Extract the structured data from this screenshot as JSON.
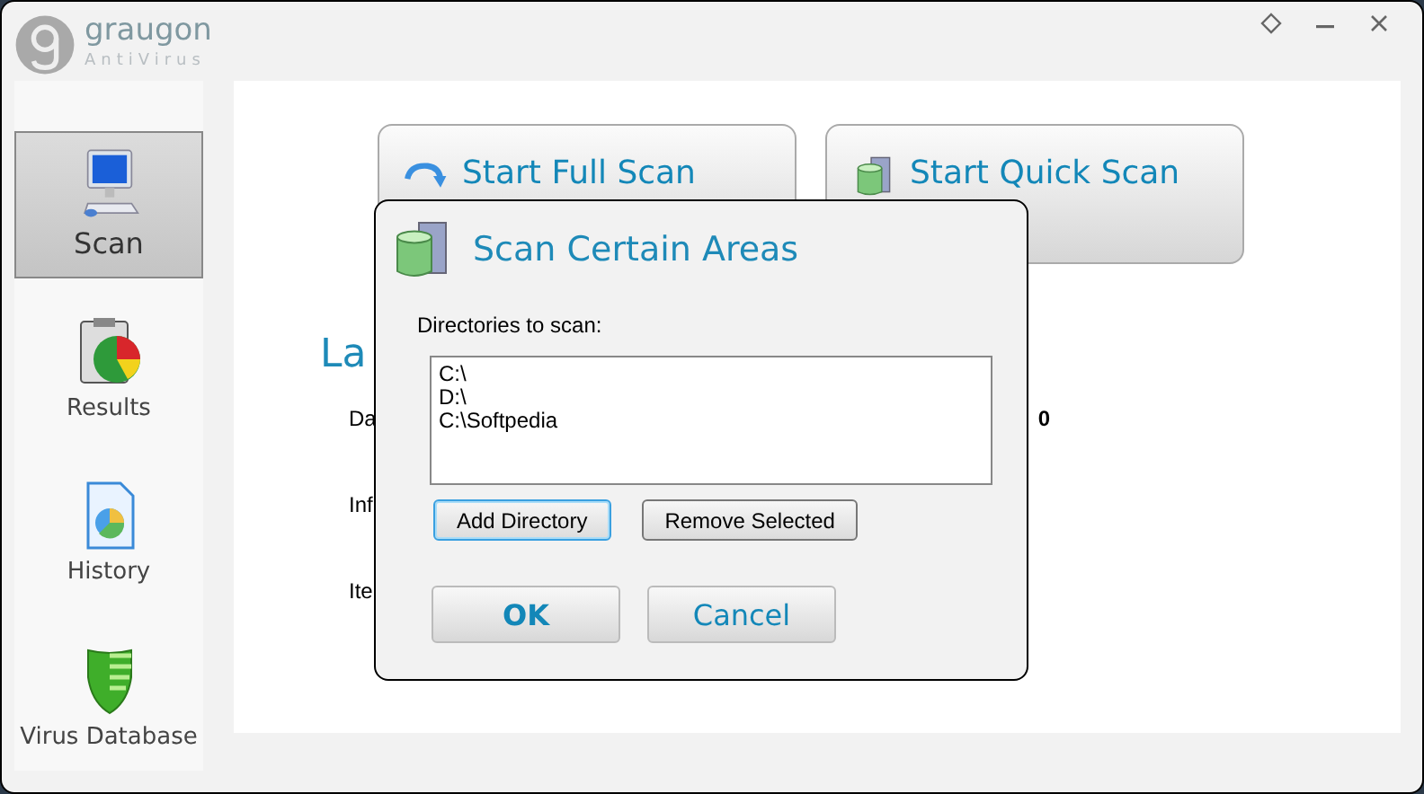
{
  "app": {
    "name": "graugon",
    "subtitle": "AntiVirus"
  },
  "sidebar": {
    "items": [
      {
        "label": "Scan",
        "kind": "monitor",
        "selected": true
      },
      {
        "label": "Results",
        "kind": "chart",
        "selected": false
      },
      {
        "label": "History",
        "kind": "document",
        "selected": false
      },
      {
        "label": "Virus Database",
        "kind": "shield",
        "selected": false
      }
    ]
  },
  "main": {
    "scan_buttons": [
      {
        "label": "Start Full Scan",
        "kind": "full"
      },
      {
        "label": "Start Quick Scan",
        "kind": "quick"
      }
    ],
    "heading": "La",
    "fields": [
      "Da",
      "Inf",
      "Ite"
    ],
    "value": "0"
  },
  "dialog": {
    "title": "Scan Certain Areas",
    "list_label": "Directories to scan:",
    "directories": [
      "C:\\",
      "D:\\",
      "C:\\Softpedia"
    ],
    "buttons": [
      {
        "label": "Add Directory",
        "focused": true
      },
      {
        "label": "Remove Selected",
        "focused": false
      }
    ],
    "actions": [
      "OK",
      "Cancel"
    ]
  }
}
